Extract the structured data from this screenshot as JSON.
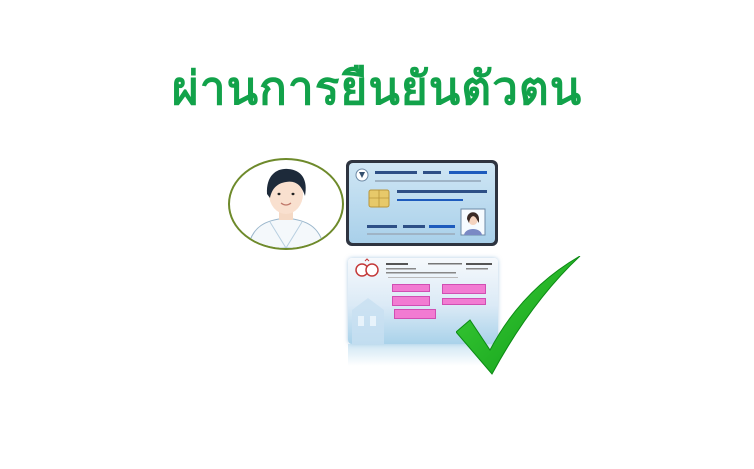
{
  "header": {
    "title": "ผ่านการยืนยันตัวตน"
  },
  "icons": {
    "avatar": "user-avatar-icon",
    "id_card": "id-card-icon",
    "document": "document-screen-icon",
    "check": "check-mark-icon"
  },
  "colors": {
    "title": "#12a24a",
    "avatar_border": "#6e8a2b",
    "check": "#16b51a",
    "card_blue": "#a9d0ea",
    "card_bar": "#1e4fa5",
    "pink_button": "#f27bd2"
  }
}
